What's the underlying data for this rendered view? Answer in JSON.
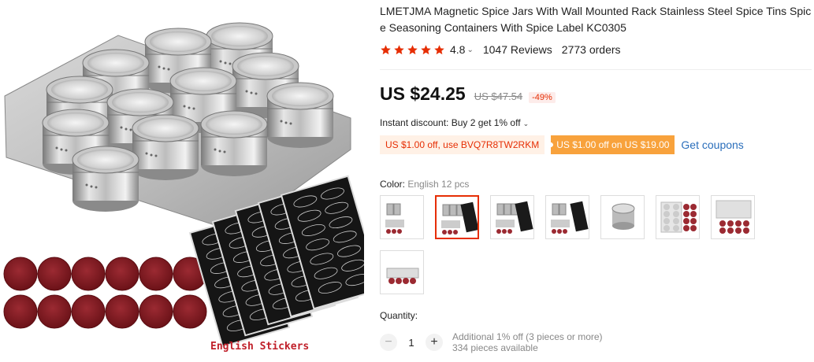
{
  "product": {
    "title": "LMETJMA Magnetic Spice Jars With Wall Mounted Rack Stainless Steel Spice Tins Spice Seasoning Containers With Spice Label KC0305",
    "image_caption": "English Stickers"
  },
  "rating": {
    "stars": 5,
    "value": "4.8",
    "reviews": "1047 Reviews",
    "orders": "2773 orders",
    "star_color": "#e62e04"
  },
  "price": {
    "current": "US $24.25",
    "original": "US $47.54",
    "discount": "-49%"
  },
  "promo": {
    "instant_discount": "Instant discount: Buy 2 get 1% off",
    "coupon_code": "US $1.00 off, use BVQ7R8TW2RKM",
    "coupon_store": "US $1.00 off on US $19.00",
    "get_coupons": "Get coupons"
  },
  "color": {
    "label": "Color:",
    "selected": "English 12 pcs",
    "options": [
      "option-1",
      "option-2",
      "option-3",
      "option-4",
      "option-5",
      "option-6",
      "option-7",
      "option-8"
    ],
    "selected_index": 1
  },
  "quantity": {
    "label": "Quantity:",
    "value": "1",
    "decrease": "−",
    "increase": "+",
    "note_additional": "Additional 1% off (3 pieces or more)",
    "note_available": "334 pieces available"
  },
  "colors": {
    "accent": "#e62e04",
    "link": "#2a6ebb",
    "coupon_bg": "#f8a23c"
  }
}
